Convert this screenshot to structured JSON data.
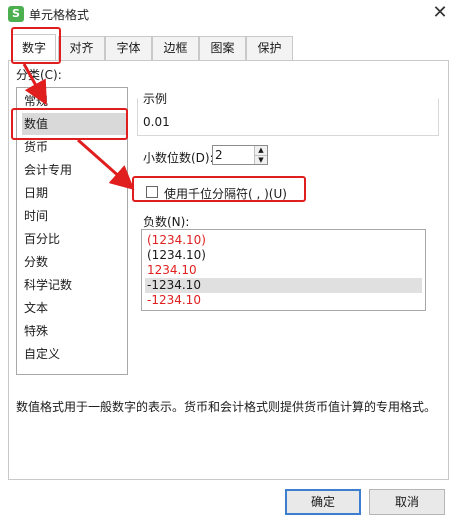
{
  "window": {
    "title": "单元格格式",
    "app_icon_glyph": "S",
    "close_glyph": "✕"
  },
  "tabs": [
    {
      "label": "数字",
      "active": true
    },
    {
      "label": "对齐",
      "active": false
    },
    {
      "label": "字体",
      "active": false
    },
    {
      "label": "边框",
      "active": false
    },
    {
      "label": "图案",
      "active": false
    },
    {
      "label": "保护",
      "active": false
    }
  ],
  "category": {
    "label": "分类(C):",
    "items": [
      "常规",
      "数值",
      "货币",
      "会计专用",
      "日期",
      "时间",
      "百分比",
      "分数",
      "科学记数",
      "文本",
      "特殊",
      "自定义"
    ],
    "selected": "数值"
  },
  "sample": {
    "label": "示例",
    "value": "0.01"
  },
  "decimal": {
    "label": "小数位数(D):",
    "value": "2",
    "up_glyph": "▲",
    "down_glyph": "▼"
  },
  "thousands": {
    "label": "使用千位分隔符( , )(U)",
    "checked": false
  },
  "negative": {
    "label": "负数(N):",
    "items": [
      {
        "text": "(1234.10)",
        "color": "#e02020"
      },
      {
        "text": "(1234.10)",
        "color": "#1a1a1a"
      },
      {
        "text": "1234.10",
        "color": "#e02020"
      },
      {
        "text": "-1234.10",
        "color": "#1a1a1a"
      },
      {
        "text": "-1234.10",
        "color": "#e02020"
      }
    ],
    "selected_index": 3
  },
  "description": "数值格式用于一般数字的表示。货币和会计格式则提供货币值计算的专用格式。",
  "buttons": {
    "ok": "确定",
    "cancel": "取消"
  },
  "colors": {
    "annotation": "#e01e1e",
    "ok_border": "#3c7fd1",
    "app_icon": "#4caf50"
  }
}
